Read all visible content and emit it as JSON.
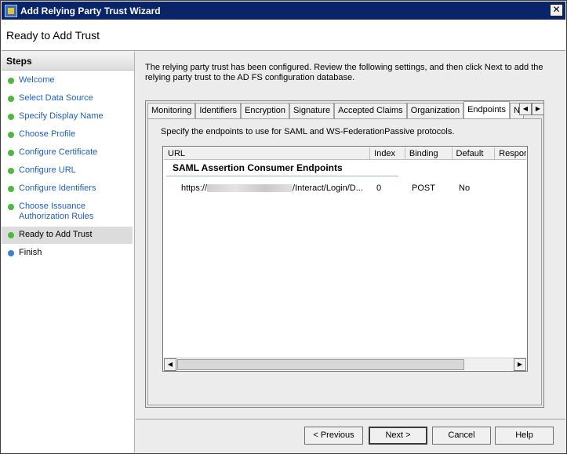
{
  "window": {
    "title": "Add Relying Party Trust Wizard",
    "close_glyph": "✕"
  },
  "header": {
    "title": "Ready to Add Trust"
  },
  "steps": {
    "heading": "Steps",
    "items": [
      {
        "label": "Welcome"
      },
      {
        "label": "Select Data Source"
      },
      {
        "label": "Specify Display Name"
      },
      {
        "label": "Choose Profile"
      },
      {
        "label": "Configure Certificate"
      },
      {
        "label": "Configure URL"
      },
      {
        "label": "Configure Identifiers"
      },
      {
        "label": "Choose Issuance Authorization Rules"
      },
      {
        "label": "Ready to Add Trust"
      },
      {
        "label": "Finish"
      }
    ]
  },
  "main": {
    "intro": "The relying party trust has been configured. Review the following settings, and then click Next to add the relying party trust to the AD FS configuration database.",
    "tabs": [
      {
        "label": "Monitoring"
      },
      {
        "label": "Identifiers"
      },
      {
        "label": "Encryption"
      },
      {
        "label": "Signature"
      },
      {
        "label": "Accepted Claims"
      },
      {
        "label": "Organization"
      },
      {
        "label": "Endpoints"
      },
      {
        "label": "N"
      }
    ],
    "tab_scroll": {
      "left": "◀",
      "right": "▶"
    },
    "endpoints": {
      "description": "Specify the endpoints to use for SAML and WS-FederationPassive protocols.",
      "columns": [
        "URL",
        "Index",
        "Binding",
        "Default",
        "Respor"
      ],
      "group": "SAML Assertion Consumer Endpoints",
      "row": {
        "url_prefix": "https://",
        "url_suffix": "/Interact/Login/D...",
        "index": "0",
        "binding": "POST",
        "default": "No"
      },
      "hscroll": {
        "left": "◀",
        "right": "▶"
      }
    }
  },
  "footer": {
    "previous": "< Previous",
    "next": "Next >",
    "cancel": "Cancel",
    "help": "Help"
  },
  "colors": {
    "titlebar": "#0a246a",
    "step_link": "#1f5fbf",
    "step_done": "#4cb83c",
    "step_pending": "#3a7fe0"
  }
}
